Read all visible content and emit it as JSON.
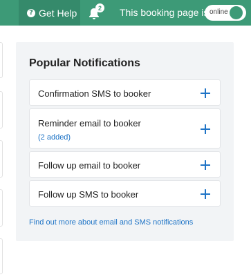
{
  "header": {
    "help_label": "Get Help",
    "notification_count": "2",
    "booking_status_label": "This booking page is",
    "toggle_label": "online"
  },
  "panel": {
    "title": "Popular Notifications",
    "items": [
      {
        "label": "Confirmation SMS to booker",
        "sub": ""
      },
      {
        "label": "Reminder email to booker",
        "sub": "(2 added)"
      },
      {
        "label": "Follow up email to booker",
        "sub": ""
      },
      {
        "label": "Follow up SMS to booker",
        "sub": ""
      }
    ],
    "link": "Find out more about email and SMS notifications"
  },
  "colors": {
    "header_bg": "#3d9a77",
    "help_bg": "#358a6b",
    "panel_bg": "#f2f4f6",
    "link": "#1f74c6"
  },
  "icons": {
    "help": "question-circle-icon",
    "bell": "bell-icon",
    "add": "plus-icon"
  }
}
